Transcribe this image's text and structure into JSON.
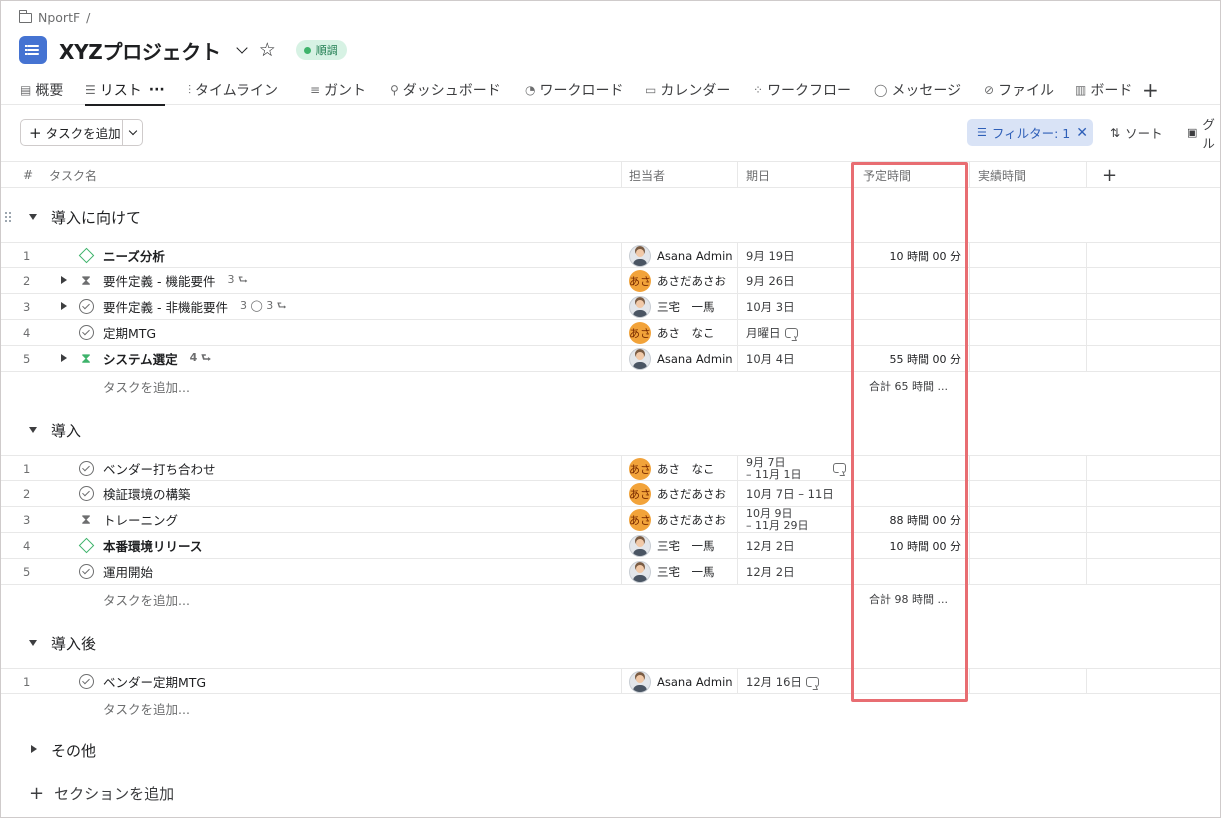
{
  "breadcrumb": {
    "workspace": "NportF",
    "separator": "/"
  },
  "project": {
    "title": "XYZプロジェクト",
    "status": "順調"
  },
  "tabs": [
    {
      "label": "概要",
      "icon": "▤",
      "active": false
    },
    {
      "label": "リスト",
      "icon": "☰",
      "active": true,
      "more": "···"
    },
    {
      "label": "タイムライン",
      "icon": "⫶",
      "active": false
    },
    {
      "label": "ガント",
      "icon": "≡",
      "active": false
    },
    {
      "label": "ダッシュボード",
      "icon": "⚲",
      "active": false
    },
    {
      "label": "ワークロード",
      "icon": "◔",
      "active": false
    },
    {
      "label": "カレンダー",
      "icon": "▭",
      "active": false
    },
    {
      "label": "ワークフロー",
      "icon": "⁘",
      "active": false
    },
    {
      "label": "メッセージ",
      "icon": "◯",
      "active": false
    },
    {
      "label": "ファイル",
      "icon": "⊘",
      "active": false
    },
    {
      "label": "ボード",
      "icon": "▥",
      "active": false
    }
  ],
  "toolbar": {
    "add_task": "タスクを追加",
    "filter": "フィルター: 1",
    "sort": "ソート",
    "group": "グル"
  },
  "columns": {
    "num": "#",
    "task": "タスク名",
    "assignee": "担当者",
    "due": "期日",
    "estimate": "予定時間",
    "actual": "実績時間",
    "add": "+"
  },
  "sections": [
    {
      "title": "導入に向けて",
      "tasks": [
        {
          "num": "1",
          "status": "milestone",
          "name": "ニーズ分析",
          "bold": true,
          "assignee": "Asana Admin",
          "avatar": "photo",
          "due": "9月 19日",
          "estimate": "10 時間 00 分"
        },
        {
          "num": "2",
          "status": "hourglass",
          "name": "要件定義 - 機能要件",
          "subtasks": "3 ⮑",
          "expand": true,
          "assignee": "あさだあさお",
          "avatar": "orange",
          "avatar_text": "あさ",
          "due": "9月 26日"
        },
        {
          "num": "3",
          "status": "check",
          "name": "要件定義 - 非機能要件",
          "subtasks": "3 ◯  3 ⮑",
          "expand": true,
          "assignee": "三宅　一馬",
          "avatar": "photo",
          "due": "10月 3日"
        },
        {
          "num": "4",
          "status": "check",
          "name": "定期MTG",
          "assignee": "あさ　なこ",
          "avatar": "orange",
          "avatar_text": "あさ",
          "due": "月曜日",
          "recurring": true
        },
        {
          "num": "5",
          "status": "hourglass-green",
          "name": "システム選定",
          "bold": true,
          "subtasks": "4 ⮑",
          "expand": true,
          "assignee": "Asana Admin",
          "avatar": "photo",
          "due": "10月 4日",
          "estimate": "55 時間 00 分"
        }
      ],
      "add_label": "タスクを追加...",
      "total": "合計  65 時間 ..."
    },
    {
      "title": "導入",
      "tasks": [
        {
          "num": "1",
          "status": "check",
          "name": "ベンダー打ち合わせ",
          "assignee": "あさ　なこ",
          "avatar": "orange",
          "avatar_text": "あさ",
          "due_line1": "9月 7日",
          "due_line2": "– 11月 1日",
          "recurring_far": true
        },
        {
          "num": "2",
          "status": "check",
          "name": "検証環境の構築",
          "assignee": "あさだあさお",
          "avatar": "orange",
          "avatar_text": "あさ",
          "due": "10月 7日 – 11日"
        },
        {
          "num": "3",
          "status": "hourglass",
          "name": "トレーニング",
          "assignee": "あさだあさお",
          "avatar": "orange",
          "avatar_text": "あさ",
          "due_line1": "10月 9日",
          "due_line2": "– 11月 29日",
          "estimate": "88 時間 00 分"
        },
        {
          "num": "4",
          "status": "milestone",
          "name": "本番環境リリース",
          "bold": true,
          "assignee": "三宅　一馬",
          "avatar": "photo",
          "due": "12月 2日",
          "estimate": "10 時間 00 分"
        },
        {
          "num": "5",
          "status": "check",
          "name": "運用開始",
          "assignee": "三宅　一馬",
          "avatar": "photo",
          "due": "12月 2日"
        }
      ],
      "add_label": "タスクを追加...",
      "total": "合計  98 時間 ..."
    },
    {
      "title": "導入後",
      "tasks": [
        {
          "num": "1",
          "status": "check",
          "name": "ベンダー定期MTG",
          "assignee": "Asana Admin",
          "avatar": "photo",
          "due": "12月 16日",
          "recurring": true
        }
      ],
      "add_label": "タスクを追加..."
    },
    {
      "title": "その他",
      "collapsed": true,
      "tasks": []
    }
  ],
  "add_section": "セクションを追加",
  "colors": {
    "accent": "#4573d2",
    "highlight": "#e86d72",
    "milestone": "#3eb36b",
    "avatar_orange": "#f2a33a",
    "filter_bg": "#d9e3f6"
  }
}
